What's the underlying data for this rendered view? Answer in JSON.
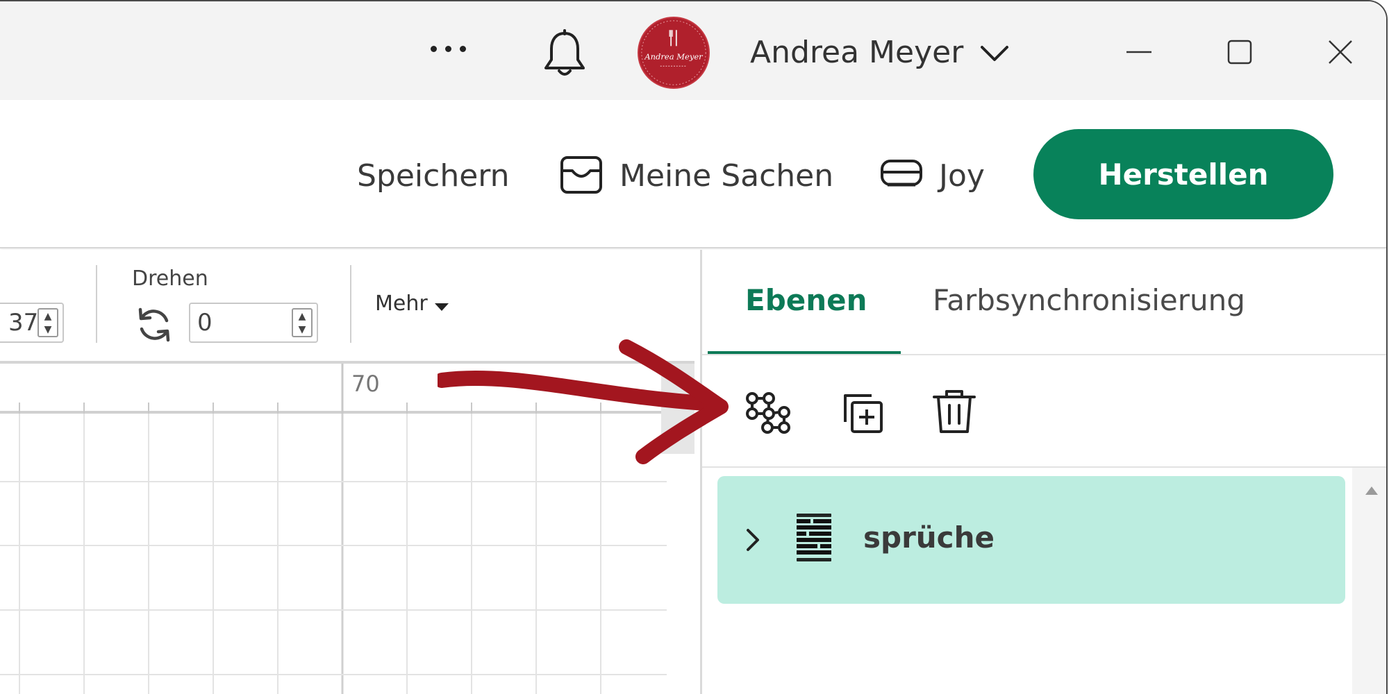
{
  "titlebar": {
    "more_icon": "more-horizontal-icon",
    "bell_icon": "bell-icon",
    "avatar_text": "Andrea Meyer",
    "user_name": "Andrea Meyer",
    "user_menu_icon": "chevron-down-icon",
    "window_controls": [
      "minimize-icon",
      "maximize-icon",
      "close-icon"
    ]
  },
  "actions": {
    "save_label": "Speichern",
    "my_items_label": "Meine Sachen",
    "my_items_icon": "inbox-icon",
    "machine_label": "Joy",
    "machine_icon": "machine-icon",
    "make_label": "Herstellen"
  },
  "toolbar": {
    "partial_value": "37",
    "rotate_label": "Drehen",
    "rotate_value": "0",
    "more_label": "Mehr"
  },
  "canvas": {
    "ruler_label": "70"
  },
  "panel": {
    "tabs": [
      "Ebenen",
      "Farbsynchronisierung"
    ],
    "active_tab": "Ebenen",
    "tools": [
      "group-icon",
      "duplicate-icon",
      "trash-icon"
    ],
    "layers": [
      {
        "name": "sprüche",
        "expanded": false,
        "selected": true
      }
    ]
  },
  "colors": {
    "accent": "#08825a",
    "tab_active": "#0d7a57",
    "layer_selected": "#bcede0",
    "annotation_arrow": "#a3161f",
    "avatar_bg": "#b0202c"
  }
}
